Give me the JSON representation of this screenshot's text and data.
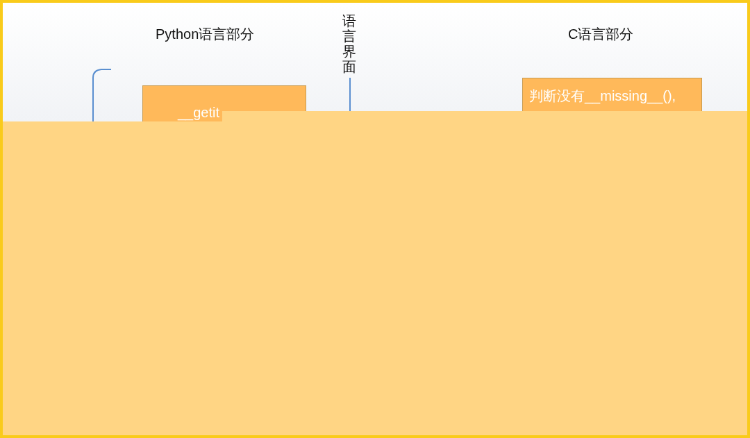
{
  "titles": [
    {
      "text": "Python语言部分"
    },
    {
      "text": "C语言部分"
    }
  ],
  "divider_label": "语言界面",
  "boxes": [
    {
      "text": "__getit"
    },
    {
      "text": "判断没有__missing__(),"
    }
  ]
}
